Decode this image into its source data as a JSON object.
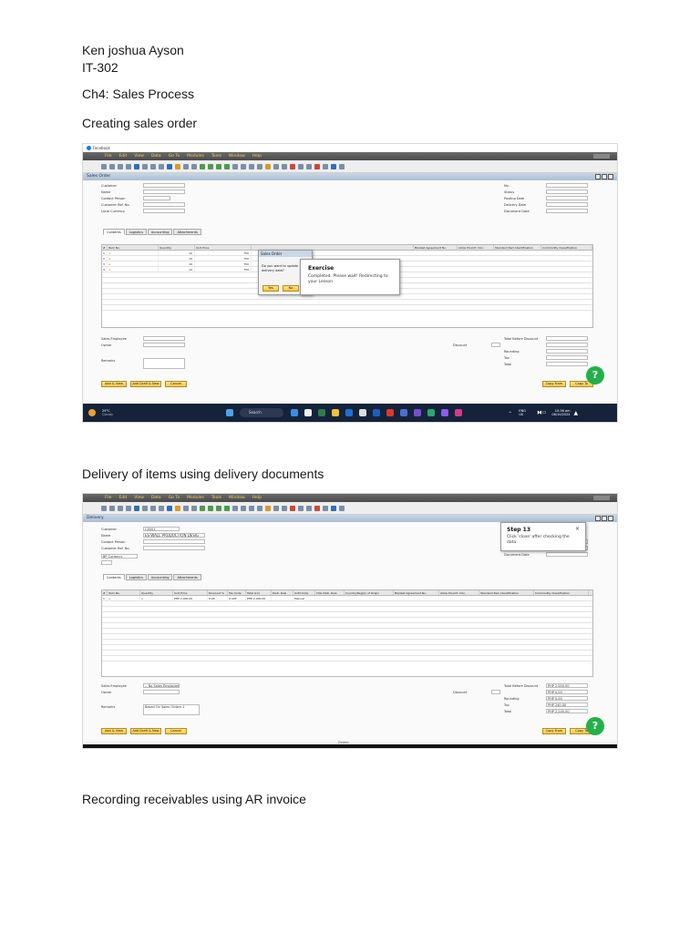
{
  "header": {
    "name": "Ken joshua Ayson",
    "section": "IT-302",
    "chapter": "Ch4: Sales Process"
  },
  "sections": [
    {
      "heading": "Creating sales order"
    },
    {
      "heading": "Delivery of items using delivery documents"
    },
    {
      "heading": "Recording receivables using AR invoice"
    }
  ],
  "shot1": {
    "browser_tab": "Facebook",
    "menu": [
      "File",
      "Edit",
      "View",
      "Data",
      "Go To",
      "Modules",
      "Tools",
      "Window",
      "Help"
    ],
    "window_title": "Sales Order",
    "fields_left": [
      "Customer",
      "Name",
      "Contact Person",
      "Customer Ref. No.",
      "Local Currency"
    ],
    "fields_right": [
      "No.",
      "Status",
      "Posting Date",
      "Delivery Date",
      "Document Date"
    ],
    "tabs": [
      "Contents",
      "Logistics",
      "Accounting",
      "Attachments"
    ],
    "grid_headers": [
      "#",
      "Item No.",
      "Quantity",
      "Unit Price"
    ],
    "grid_rows": [
      {
        "n": "1",
        "qty": "10",
        "price": "750"
      },
      {
        "n": "2",
        "qty": "10",
        "price": "750"
      },
      {
        "n": "3",
        "qty": "10",
        "price": "750"
      },
      {
        "n": "4",
        "qty": "10",
        "price": "750"
      }
    ],
    "right_headers": [
      "Blanket Agreement No.",
      "Allow Procmt. Doc.",
      "Standard Item Identification",
      "Commodity Classification"
    ],
    "dialog_title": "Sales Order",
    "dialog_text": "Do you want to update delivery date?",
    "dialog_yes": "Yes",
    "dialog_no": "No",
    "exercise_title": "Exercise",
    "exercise_text": "Completed. Please wait! Redirecting to your Lesson",
    "bottom_labels": [
      "Sales Employee",
      "Owner",
      "Remarks"
    ],
    "totals_labels": [
      "Total Before Discount",
      "Discount",
      "Rounding",
      "Tax",
      "Total"
    ],
    "buttons_left": [
      "Add & View",
      "Add Draft & New",
      "Cancel"
    ],
    "buttons_right": [
      "Copy From",
      "Copy To"
    ],
    "help_label": "?",
    "taskbar_weather": "29°C",
    "taskbar_weather_sub": "Cloudy",
    "taskbar_search": "Search",
    "taskbar_lang": "ENG",
    "taskbar_lang_sub": "US",
    "taskbar_time": "10:36 am",
    "taskbar_date": "06/10/2024"
  },
  "shot2": {
    "menu": [
      "File",
      "Edit",
      "View",
      "Data",
      "Go To",
      "Modules",
      "Tools",
      "Window",
      "Help"
    ],
    "window_title": "Delivery",
    "fields_left": [
      "Customer",
      "Name",
      "Contact Person",
      "Customer Ref. No.",
      "BP Currency"
    ],
    "customer_value": "C0001",
    "name_value": "ES WALL PRODUCTION DESIG",
    "fields_right": [
      "Posting Date",
      "Delivery Date",
      "Document Date"
    ],
    "tabs": [
      "Contents",
      "Logistics",
      "Accounting",
      "Attachments"
    ],
    "grid_headers": [
      "#",
      "Item No.",
      "Quantity",
      "Unit Price",
      "Discount %",
      "Tax Code",
      "Total (LC)",
      "Distr. Rule",
      "UoM Code",
      "CSG Distr. Rule",
      "Country/Region of Origin",
      "Blanket Agreement No.",
      "Allow Procmt. Doc.",
      "Standard Item Identification",
      "Commodity Classification"
    ],
    "grid_row": {
      "n": "1",
      "qty": "1",
      "price": "PHP 2,000.00",
      "disc": "0.00",
      "tax": "O-VAT",
      "total": "PHP 2,000.00",
      "uom": "Manual"
    },
    "step_title": "Step 13",
    "step_text": "Click 'close' after checking the data",
    "step_close": "×",
    "bottom_labels": [
      "Sales Employee",
      "Owner",
      "Remarks"
    ],
    "sales_emp_value": "-- No Sales Employee --",
    "remarks_value": "Based On Sales Orders 1",
    "totals_labels": [
      "Total Before Discount",
      "Discount",
      "Rounding",
      "Tax",
      "Total"
    ],
    "totals_values": [
      "PHP 2,000.00",
      "PHP 0.00",
      "PHP 0.00",
      "PHP 240.00",
      "PHP 2,240.00"
    ],
    "buttons_left": [
      "Add & View",
      "Add Draft & New",
      "Cancel"
    ],
    "buttons_right": [
      "Copy From",
      "Copy To"
    ],
    "help_label": "?",
    "footer_label": "Delete"
  }
}
